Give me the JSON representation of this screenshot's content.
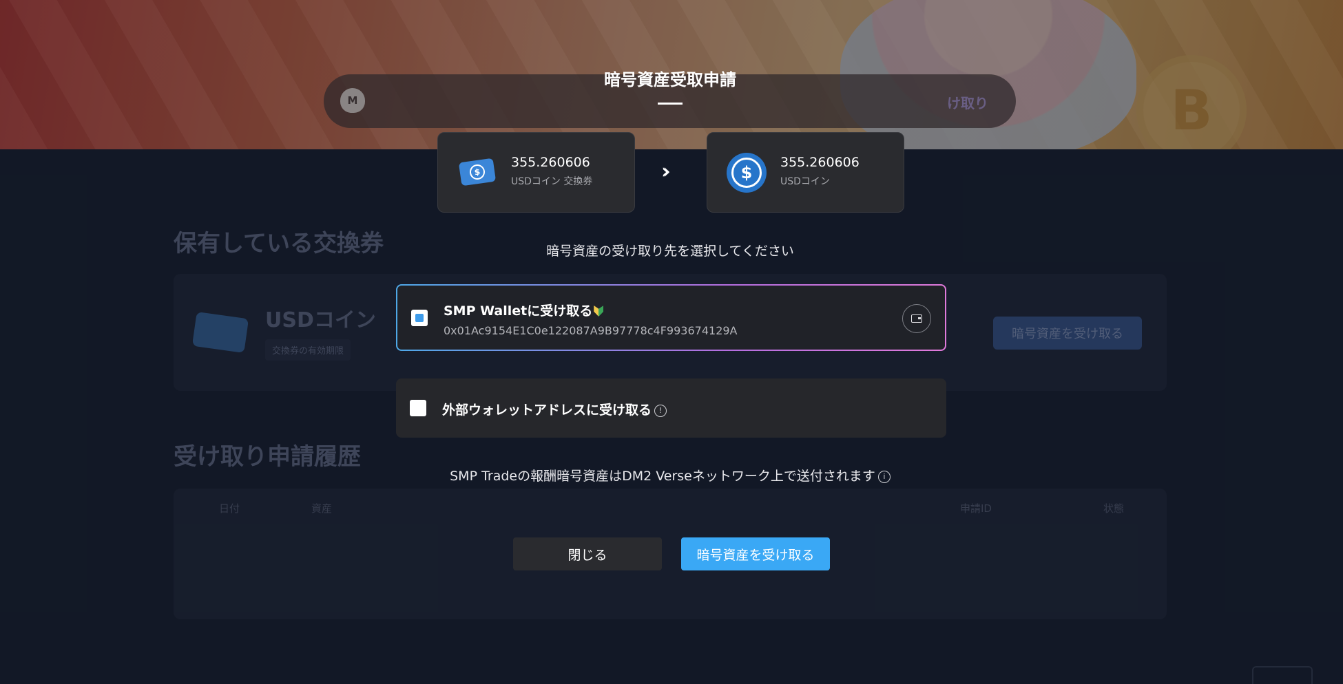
{
  "background": {
    "pill_right_text": "け取り",
    "pill_icon_letter": "M",
    "holdings_title": "保有している交換券",
    "card_name": "USDコイン",
    "card_expiry": "交換券の有効期限",
    "card_button": "暗号資産を受け取る",
    "history_title": "受け取り申請履歴",
    "table_headers": [
      "日付",
      "資産",
      "申請ID",
      "状態"
    ]
  },
  "modal": {
    "title": "暗号資産受取申請",
    "from_asset": {
      "amount": "355.260606",
      "label": "USDコイン 交換券"
    },
    "to_asset": {
      "amount": "355.260606",
      "label": "USDコイン"
    },
    "prompt": "暗号資産の受け取り先を選択してください",
    "options": [
      {
        "title": "SMP Walletに受け取る",
        "address": "0x01Ac9154E1C0e122087A9B97778c4F993674129A",
        "selected": true
      },
      {
        "title": "外部ウォレットアドレスに受け取る",
        "selected": false
      }
    ],
    "note": "SMP Tradeの報酬暗号資産はDM2 Verseネットワーク上で送付されます",
    "close_label": "閉じる",
    "receive_label": "暗号資産を受け取る"
  },
  "icons": {
    "ticket": "ticket-dollar-icon",
    "coin": "usdc-coin-icon",
    "arrow": "double-chevron-right-icon",
    "wallet": "wallet-icon",
    "info": "info-circle-icon",
    "leaf": "beginner-leaf-icon"
  },
  "colors": {
    "accent": "#3aa8f5",
    "usdc": "#2775ca"
  }
}
